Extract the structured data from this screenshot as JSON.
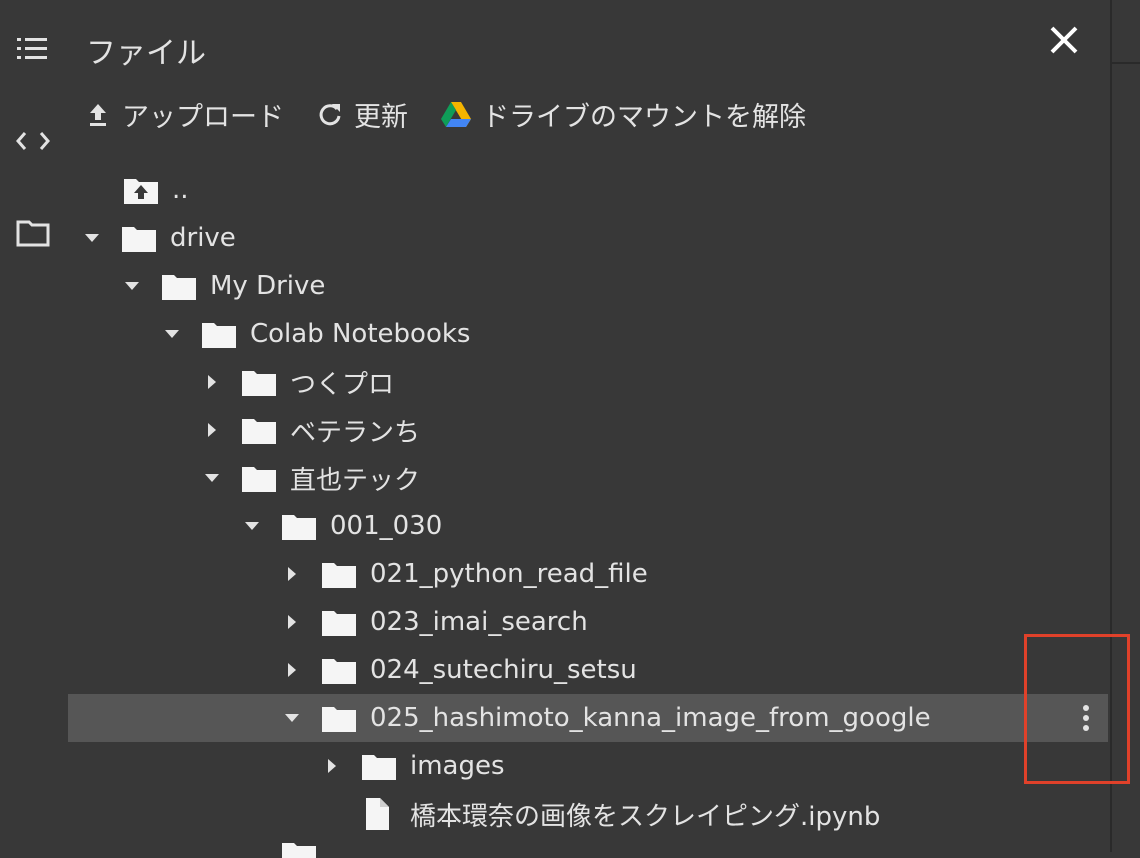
{
  "panel": {
    "title": "ファイル",
    "close_icon": "close-icon"
  },
  "left_rail": {
    "icons": [
      "table-of-contents-icon",
      "code-icon",
      "folder-icon"
    ]
  },
  "toolbar": {
    "upload_label": "アップロード",
    "refresh_label": "更新",
    "unmount_label": "ドライブのマウントを解除"
  },
  "tree": {
    "parent_label": "..",
    "items": [
      {
        "label": "drive",
        "type": "folder",
        "expanded": true
      },
      {
        "label": "My Drive",
        "type": "folder",
        "expanded": true
      },
      {
        "label": "Colab Notebooks",
        "type": "folder",
        "expanded": true
      },
      {
        "label": "つくプロ",
        "type": "folder",
        "expanded": false
      },
      {
        "label": "ベテランち",
        "type": "folder",
        "expanded": false
      },
      {
        "label": "直也テック",
        "type": "folder",
        "expanded": true
      },
      {
        "label": "001_030",
        "type": "folder",
        "expanded": true
      },
      {
        "label": "021_python_read_file",
        "type": "folder",
        "expanded": false
      },
      {
        "label": "023_imai_search",
        "type": "folder",
        "expanded": false
      },
      {
        "label": "024_sutechiru_setsu",
        "type": "folder",
        "expanded": false
      },
      {
        "label": "025_hashimoto_kanna_image_from_google",
        "type": "folder",
        "expanded": true,
        "selected": true
      },
      {
        "label": "images",
        "type": "folder",
        "expanded": false
      },
      {
        "label": "橋本環奈の画像をスクレイピング.ipynb",
        "type": "file"
      }
    ]
  },
  "colors": {
    "background": "#383838",
    "selected_row": "#565656",
    "text": "#e3e3e3",
    "highlight_box": "#e0412a",
    "drive_green": "#0f9d58",
    "drive_yellow": "#f4b400",
    "drive_blue": "#4285f4"
  }
}
